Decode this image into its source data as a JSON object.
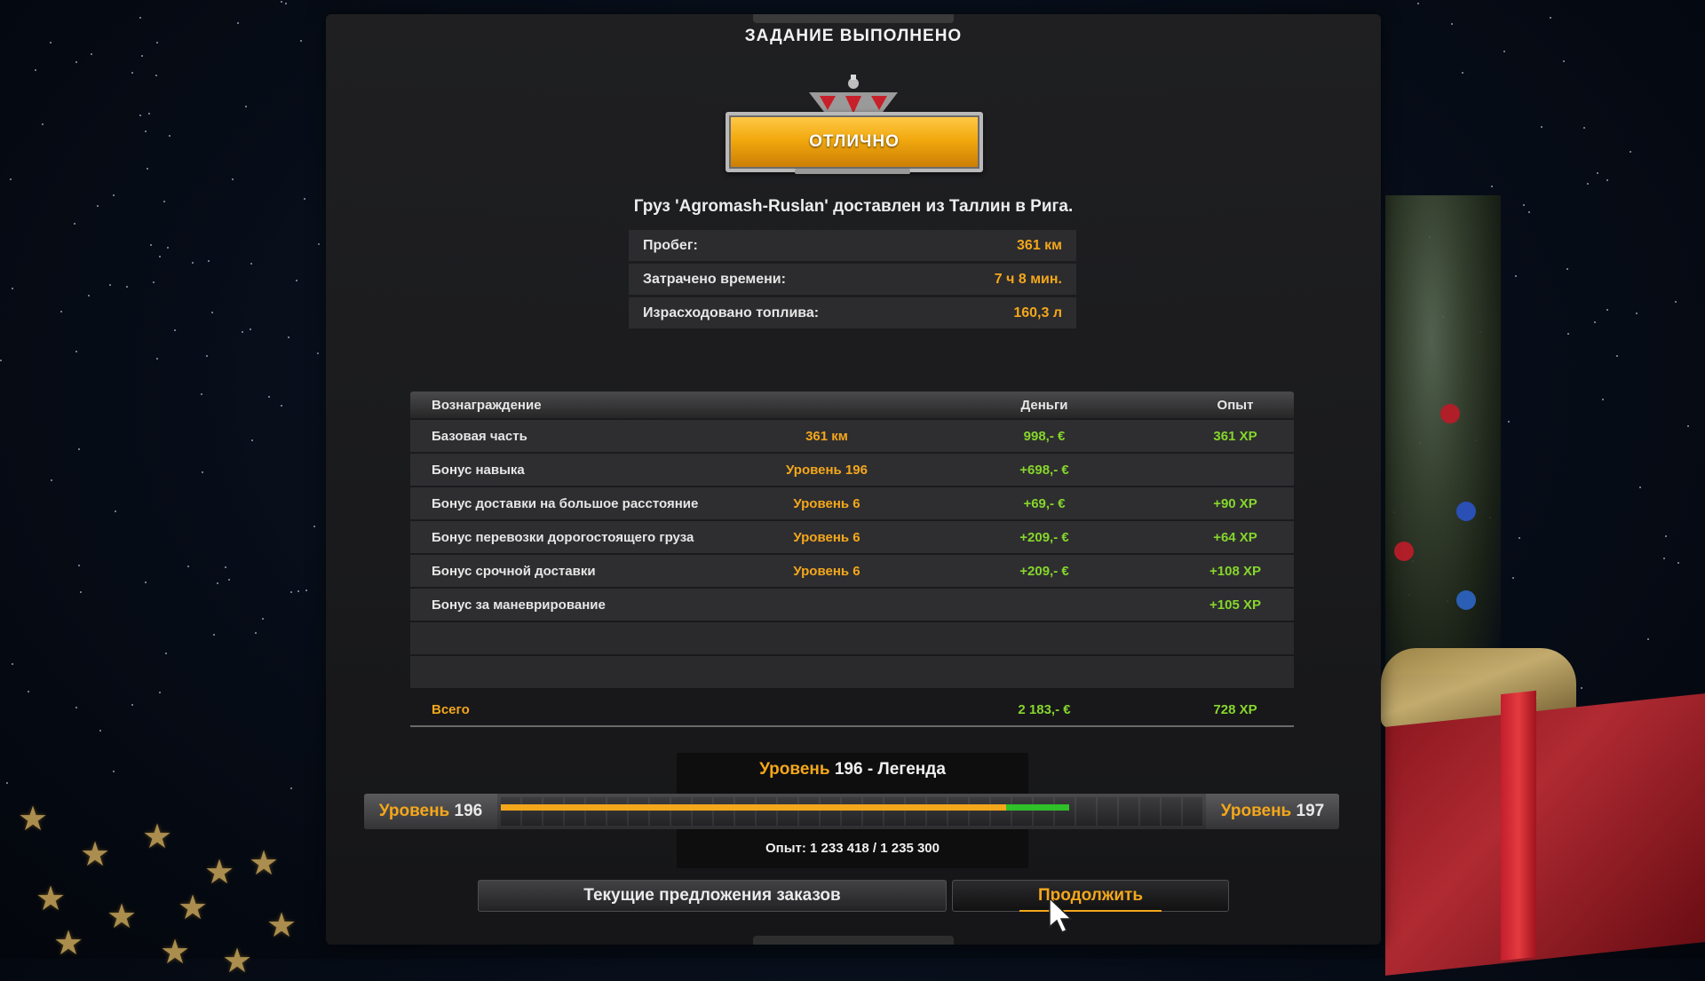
{
  "title": "ЗАДАНИЕ ВЫПОЛНЕНО",
  "rating": "ОТЛИЧНО",
  "cargo_line": "Груз 'Agromash-Ruslan' доставлен из Таллин в Рига.",
  "stats": [
    {
      "label": "Пробег:",
      "value": "361 км"
    },
    {
      "label": "Затрачено времени:",
      "value": "7 ч 8 мин."
    },
    {
      "label": "Израсходовано топлива:",
      "value": "160,3 л"
    }
  ],
  "table": {
    "headers": {
      "reward": "Вознаграждение",
      "money": "Деньги",
      "xp": "Опыт"
    },
    "rows": [
      {
        "name": "Базовая часть",
        "level": "361 км",
        "money": "998,- €",
        "xp": "361 XP"
      },
      {
        "name": "Бонус навыка",
        "level": "Уровень 196",
        "money": "+698,- €",
        "xp": ""
      },
      {
        "name": "Бонус доставки на большое расстояние",
        "level": "Уровень 6",
        "money": "+69,- €",
        "xp": "+90 XP"
      },
      {
        "name": "Бонус перевозки дорогостоящего груза",
        "level": "Уровень 6",
        "money": "+209,- €",
        "xp": "+64 XP"
      },
      {
        "name": "Бонус срочной доставки",
        "level": "Уровень 6",
        "money": "+209,- €",
        "xp": "+108 XP"
      },
      {
        "name": "Бонус за маневрирование",
        "level": "",
        "money": "",
        "xp": "+105 XP"
      }
    ],
    "total": {
      "name": "Всего",
      "money": "2 183,- €",
      "xp": "728 XP"
    }
  },
  "level": {
    "word": "Уровень",
    "current": "196",
    "title_rest": "- Легенда",
    "next": "197",
    "xp_text": "Опыт: 1 233 418 / 1 235 300",
    "progress_before": 0.72,
    "progress_gained": 0.09
  },
  "buttons": {
    "offers": "Текущие предложения заказов",
    "continue": "Продолжить"
  },
  "colors": {
    "accent_orange": "#f4a71b",
    "xp_green": "#86d62c",
    "bar_green": "#2fc02a"
  }
}
